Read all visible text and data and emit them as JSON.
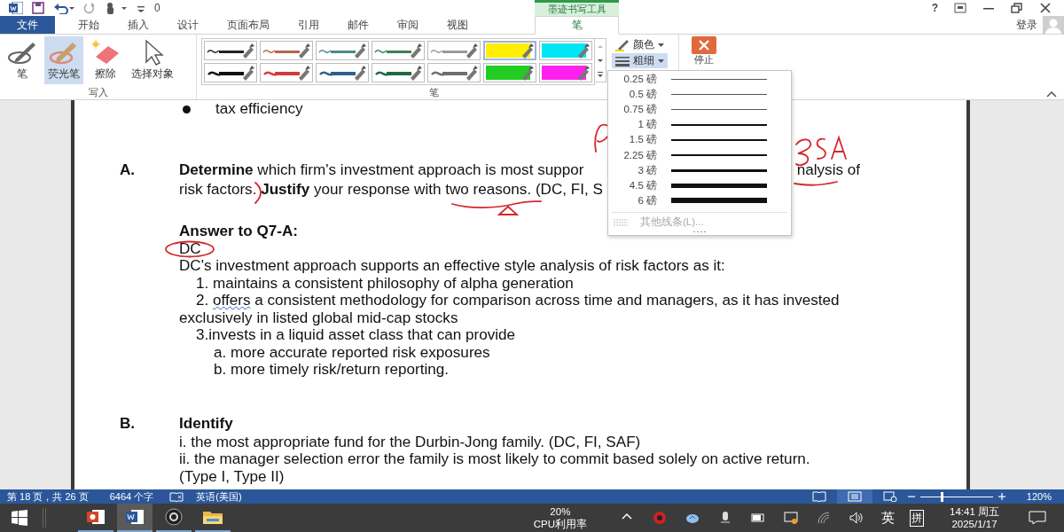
{
  "quick_access": {
    "counter": "0"
  },
  "help": "?",
  "contextual_group": "墨迹书写工具",
  "tabs": [
    {
      "label": "文件",
      "kind": "file",
      "selected": false
    },
    {
      "label": "开始",
      "kind": "tab",
      "selected": false
    },
    {
      "label": "插入",
      "kind": "tab",
      "selected": false
    },
    {
      "label": "设计",
      "kind": "tab",
      "selected": false
    },
    {
      "label": "页面布局",
      "kind": "tab",
      "selected": false
    },
    {
      "label": "引用",
      "kind": "tab",
      "selected": false
    },
    {
      "label": "邮件",
      "kind": "tab",
      "selected": false
    },
    {
      "label": "审阅",
      "kind": "tab",
      "selected": false
    },
    {
      "label": "视图",
      "kind": "tab",
      "selected": false
    },
    {
      "label": "笔",
      "kind": "contextual",
      "selected": true
    }
  ],
  "account": {
    "sign_in": "登录"
  },
  "ribbon": {
    "write_group": {
      "label": "写入",
      "tools": [
        {
          "label": "笔",
          "kind": "pen",
          "selected": false
        },
        {
          "label": "荧光笔",
          "kind": "highlighter",
          "selected": true
        },
        {
          "label": "擦除",
          "kind": "eraser",
          "selected": false
        },
        {
          "label": "选择对象",
          "kind": "select",
          "selected": false
        }
      ]
    },
    "pens_group": {
      "label": "笔",
      "pens": [
        {
          "kind": "thin",
          "color": "#222222",
          "selected": false
        },
        {
          "kind": "thin",
          "color": "#b5654f",
          "selected": false
        },
        {
          "kind": "thin",
          "color": "#4a8a88",
          "selected": false
        },
        {
          "kind": "thin",
          "color": "#3f8050",
          "selected": false
        },
        {
          "kind": "thin",
          "color": "#9a9a9a",
          "selected": false
        },
        {
          "kind": "highlighter",
          "color": "#ffee00",
          "selected": true
        },
        {
          "kind": "highlighter",
          "color": "#00e5f5",
          "selected": false
        },
        {
          "kind": "thick",
          "color": "#111111",
          "selected": false
        },
        {
          "kind": "thick",
          "color": "#d43a3a",
          "selected": false
        },
        {
          "kind": "thick",
          "color": "#2f5f8a",
          "selected": false
        },
        {
          "kind": "thick",
          "color": "#1f6a40",
          "selected": false
        },
        {
          "kind": "thick",
          "color": "#6e6e6e",
          "selected": false
        },
        {
          "kind": "highlighter",
          "color": "#22cc22",
          "selected": false
        },
        {
          "kind": "highlighter",
          "color": "#ff22ee",
          "selected": false
        }
      ],
      "color_button": "颜色",
      "weight_button": {
        "label": "粗细",
        "expanded": true
      }
    },
    "stop_button": "停止"
  },
  "weight_menu": {
    "options": [
      {
        "label": "0.25 磅"
      },
      {
        "label": "0.5 磅"
      },
      {
        "label": "0.75 磅"
      },
      {
        "label": "1 磅"
      },
      {
        "label": "1.5 磅"
      },
      {
        "label": "2.25 磅"
      },
      {
        "label": "3 磅"
      },
      {
        "label": "4.5 磅"
      },
      {
        "label": "6 磅"
      }
    ],
    "more": {
      "label": "其他线条(L)...",
      "disabled": true
    }
  },
  "document": [
    {
      "kind": "bullet",
      "text": "tax efficiency"
    },
    {
      "kind": "question",
      "marker": "A.",
      "lines": [
        {
          "left": "**Determine** which firm's investment approach is most suppor",
          "right": "nalysis of"
        },
        {
          "left": "risk factors. **Justify** your response with two reasons. (DC, FI, S"
        }
      ]
    },
    {
      "kind": "heading",
      "text": "Answer to Q7-A:"
    },
    {
      "kind": "text",
      "text": "DC"
    },
    {
      "kind": "text",
      "text": "DC's investment approach supports an effective style analysis of risk factors as it:"
    },
    {
      "kind": "list1",
      "text": "1. maintains a consistent philosophy of alpha generation"
    },
    {
      "kind": "list1",
      "prefix": "2. ",
      "misspelled": "offers",
      "text": " a consistent methodology for comparison across time and managers, as it has invested"
    },
    {
      "kind": "text",
      "text": "exclusively in listed global mid-cap stocks"
    },
    {
      "kind": "list1",
      "text": "3.invests in a liquid asset class that can provide"
    },
    {
      "kind": "list2",
      "text": "a. more accurate reported risk exposures"
    },
    {
      "kind": "list2",
      "text": "b. more timely risk/return reporting."
    },
    {
      "kind": "question",
      "marker": "B.",
      "lines": [
        {
          "left": "Identify",
          "bold": true
        }
      ]
    },
    {
      "kind": "text",
      "text": "i. the most appropriate fund for the Durbin-Jong family. (DC, FI, SAF)"
    },
    {
      "kind": "text",
      "text": "ii. the manager selection error the family is most likely to commit based solely on active return."
    },
    {
      "kind": "text",
      "text": "(Type I, Type II)"
    }
  ],
  "status_bar": {
    "page": "第 18 页，共 26 页",
    "words": "6464 个字",
    "language": "英语(美国)",
    "zoom": "120%",
    "zoom_level": {
      "level": 0.3
    }
  },
  "taskbar": {
    "apps": [
      {
        "kind": "slides",
        "selected": false
      },
      {
        "kind": "word",
        "selected": true
      },
      {
        "kind": "recorder",
        "selected": false
      },
      {
        "kind": "folder",
        "selected": false
      }
    ],
    "cpu_value": "20%",
    "cpu_label": "CPU利用率",
    "ime_lang": "英",
    "ime_mode": "拼",
    "time": "14:41 周五",
    "date": "2025/1/17"
  }
}
